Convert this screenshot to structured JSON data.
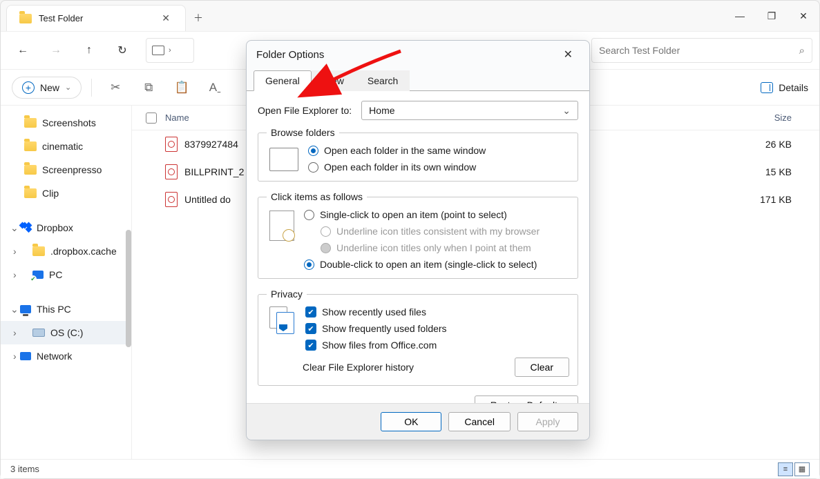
{
  "window": {
    "tab_title": "Test Folder",
    "win_minimize": "—",
    "win_restore": "❐",
    "win_close": "✕"
  },
  "search": {
    "placeholder": "Search Test Folder"
  },
  "cmdbar": {
    "new_label": "New",
    "details_label": "Details"
  },
  "nav": {
    "items": [
      {
        "label": "Screenshots",
        "type": "folder"
      },
      {
        "label": "cinematic",
        "type": "folder"
      },
      {
        "label": "Screenpresso",
        "type": "folder"
      },
      {
        "label": "Clip",
        "type": "folder"
      }
    ],
    "dropbox": "Dropbox",
    "dropbox_cache": ".dropbox.cache",
    "pc_shortcut": "PC",
    "this_pc": "This PC",
    "os_c": "OS (C:)",
    "network": "Network"
  },
  "columns": {
    "name": "Name",
    "size": "Size"
  },
  "files": [
    {
      "name": "8379927484",
      "size": "26 KB"
    },
    {
      "name": "BILLPRINT_2",
      "size": "15 KB"
    },
    {
      "name": "Untitled do",
      "size": "171 KB"
    }
  ],
  "status": {
    "count": "3 items"
  },
  "dialog": {
    "title": "Folder Options",
    "tabs": {
      "general": "General",
      "view": "View",
      "search": "Search"
    },
    "open_label": "Open File Explorer to:",
    "open_value": "Home",
    "browse": {
      "legend": "Browse folders",
      "same": "Open each folder in the same window",
      "own": "Open each folder in its own window"
    },
    "click": {
      "legend": "Click items as follows",
      "single": "Single-click to open an item (point to select)",
      "underline_browser": "Underline icon titles consistent with my browser",
      "underline_point": "Underline icon titles only when I point at them",
      "double": "Double-click to open an item (single-click to select)"
    },
    "privacy": {
      "legend": "Privacy",
      "recent": "Show recently used files",
      "frequent": "Show frequently used folders",
      "office": "Show files from Office.com",
      "clear_label": "Clear File Explorer history",
      "clear_btn": "Clear"
    },
    "restore": "Restore Defaults",
    "ok": "OK",
    "cancel": "Cancel",
    "apply": "Apply"
  }
}
